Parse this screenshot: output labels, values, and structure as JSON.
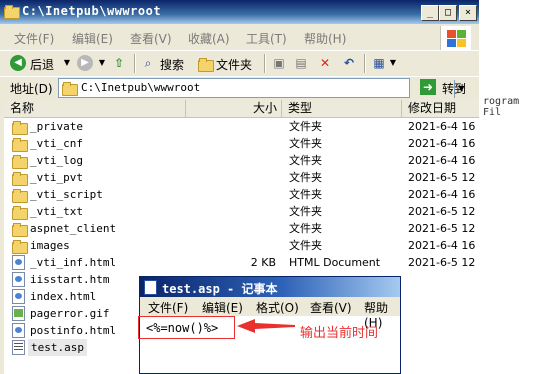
{
  "explorer": {
    "title": "C:\\Inetpub\\wwwroot",
    "window_buttons": {
      "minimize": "_",
      "maximize": "□",
      "close": "×"
    },
    "menu": [
      "文件(F)",
      "编辑(E)",
      "查看(V)",
      "收藏(A)",
      "工具(T)",
      "帮助(H)"
    ],
    "toolbar": {
      "back_label": "后退",
      "search_label": "搜索",
      "folders_label": "文件夹"
    },
    "address": {
      "label": "地址(D)",
      "value": "C:\\Inetpub\\wwwroot",
      "go_label": "转到"
    },
    "columns": {
      "name": "名称",
      "size": "大小",
      "type": "类型",
      "modified": "修改日期"
    },
    "files": [
      {
        "name": "_private",
        "size": "",
        "type": "文件夹",
        "date": "2021-6-4 16",
        "icon": "folder"
      },
      {
        "name": "_vti_cnf",
        "size": "",
        "type": "文件夹",
        "date": "2021-6-4 16",
        "icon": "folder"
      },
      {
        "name": "_vti_log",
        "size": "",
        "type": "文件夹",
        "date": "2021-6-4 16",
        "icon": "folder"
      },
      {
        "name": "_vti_pvt",
        "size": "",
        "type": "文件夹",
        "date": "2021-6-5 12",
        "icon": "folder"
      },
      {
        "name": "_vti_script",
        "size": "",
        "type": "文件夹",
        "date": "2021-6-4 16",
        "icon": "folder"
      },
      {
        "name": "_vti_txt",
        "size": "",
        "type": "文件夹",
        "date": "2021-6-5 12",
        "icon": "folder"
      },
      {
        "name": "aspnet_client",
        "size": "",
        "type": "文件夹",
        "date": "2021-6-5 12",
        "icon": "folder"
      },
      {
        "name": "images",
        "size": "",
        "type": "文件夹",
        "date": "2021-6-4 16",
        "icon": "folder"
      },
      {
        "name": "_vti_inf.html",
        "size": "2 KB",
        "type": "HTML Document",
        "date": "2021-6-5 12",
        "icon": "html"
      },
      {
        "name": "iisstart.htm",
        "size": "",
        "type": "",
        "date": "",
        "icon": "html"
      },
      {
        "name": "index.html",
        "size": "",
        "type": "",
        "date": "",
        "icon": "html"
      },
      {
        "name": "pagerror.gif",
        "size": "",
        "type": "",
        "date": "",
        "icon": "gif"
      },
      {
        "name": "postinfo.html",
        "size": "",
        "type": "",
        "date": "",
        "icon": "html"
      },
      {
        "name": "test.asp",
        "size": "",
        "type": "",
        "date": "",
        "icon": "asp"
      }
    ]
  },
  "background_text": "rogram Fil",
  "notepad": {
    "title": "test.asp - 记事本",
    "menu": [
      "文件(F)",
      "编辑(E)",
      "格式(O)",
      "查看(V)",
      "帮助(H)"
    ],
    "content": "<%=now()%>"
  },
  "annotation": {
    "text": "输出当前时间",
    "color": "#e8312f"
  }
}
